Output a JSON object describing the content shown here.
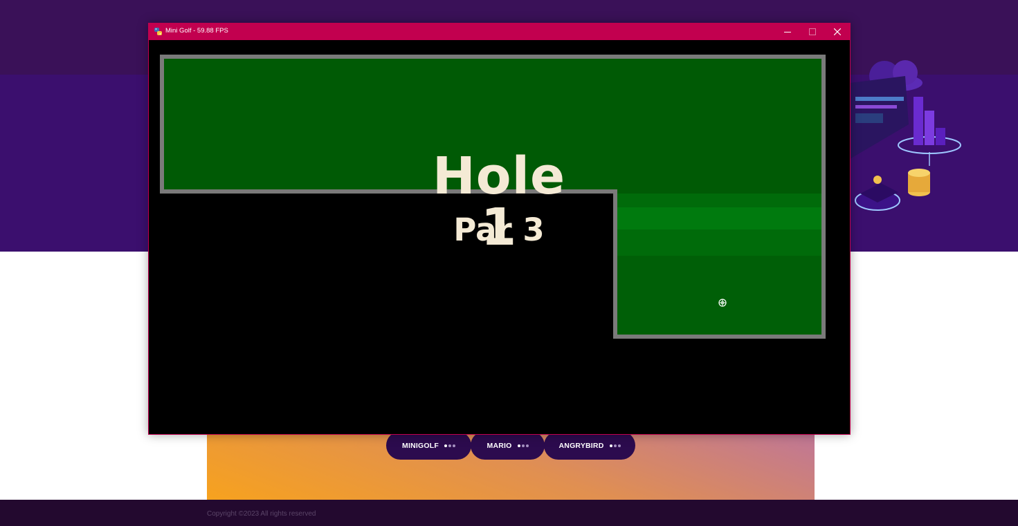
{
  "window": {
    "title": "Mini Golf - 59.88 FPS",
    "icon": "python-icon",
    "controls": [
      "minimize-icon",
      "maximize-icon",
      "close-icon"
    ],
    "accent_color": "#c2004f"
  },
  "game": {
    "hole_title": "Hole 1",
    "par_text": "Par 3",
    "colors": {
      "background": "#000000",
      "fairway": "#005a05",
      "fairway_light": "#006b0a",
      "fairway_stripe": "#007a0e",
      "wall": "#7a7a7a",
      "text": "#f4ead5"
    },
    "cursor": "crosshair-cursor-icon"
  },
  "page": {
    "nav_buttons": [
      {
        "label": "MINIGOLF"
      },
      {
        "label": "MARIO"
      },
      {
        "label": "ANGRYBIRD"
      }
    ],
    "footer_text": "Copyright ©2023 All rights reserved",
    "colors": {
      "hero": "#3b0f6e",
      "footer": "#23092f",
      "button": "#2c0b4e"
    }
  }
}
